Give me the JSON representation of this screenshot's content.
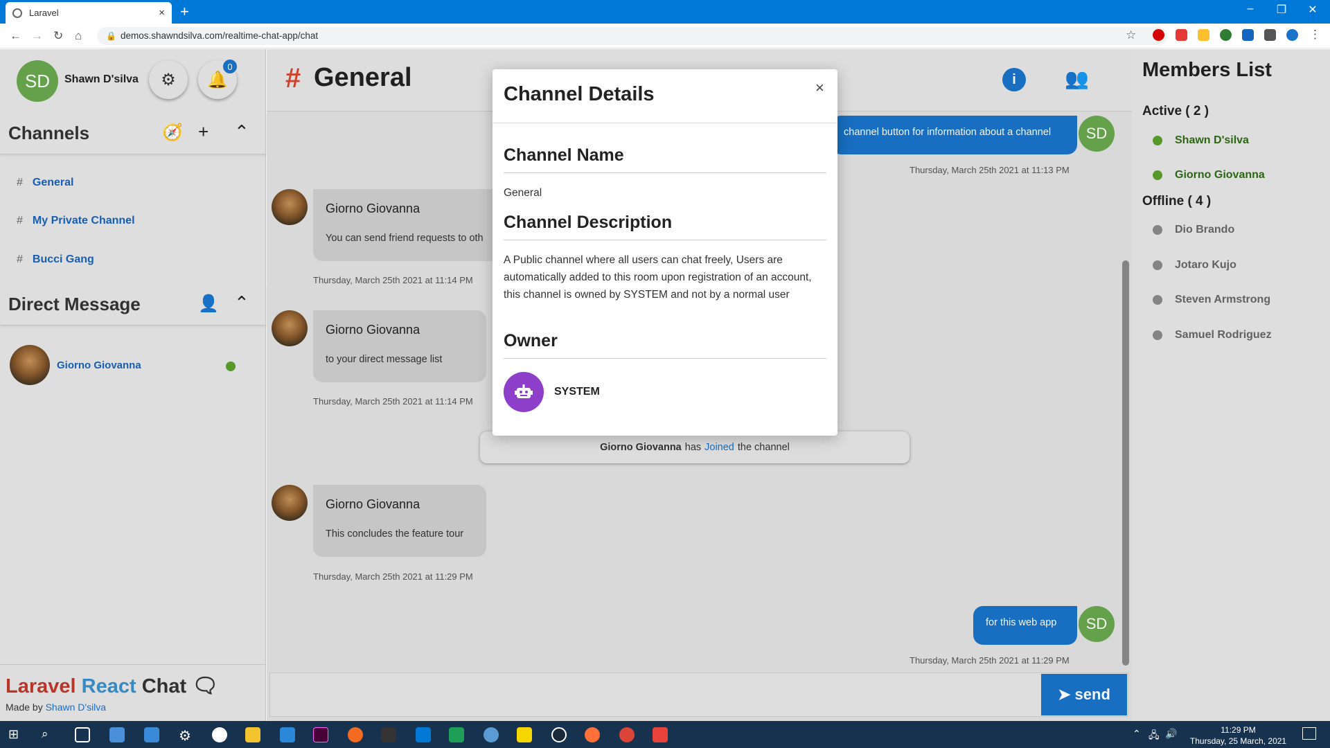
{
  "browser": {
    "tab_title": "Laravel",
    "tab_close": "×",
    "new_tab": "+",
    "url": "demos.shawndsilva.com/realtime-chat-app/chat",
    "minimize": "–",
    "restore": "❐",
    "close": "✕"
  },
  "user": {
    "initials": "SD",
    "name": "Shawn D'silva",
    "notifications": "0"
  },
  "channels": {
    "title": "Channels",
    "items": [
      {
        "hash": "#",
        "name": "General"
      },
      {
        "hash": "#",
        "name": "My Private Channel"
      },
      {
        "hash": "#",
        "name": "Bucci Gang"
      }
    ]
  },
  "direct": {
    "title": "Direct Message",
    "items": [
      {
        "name": "Giorno Giovanna",
        "status_color": "#5aa02c"
      }
    ]
  },
  "brand": {
    "laravel": "Laravel",
    "react": "React",
    "chat": "Chat",
    "made_by": "Made by",
    "author": "Shawn D'silva"
  },
  "chat": {
    "channel_hash": "#",
    "channel_name": "General",
    "info_icon": "i",
    "messages": {
      "m1": {
        "text": "channel button for information about a channel",
        "initials": "SD",
        "time": "Thursday, March 25th 2021 at 11:13 PM"
      },
      "m2": {
        "name": "Giorno Giovanna",
        "text": "You can send friend requests to oth",
        "time": "Thursday, March 25th 2021 at 11:14 PM"
      },
      "m3": {
        "name": "Giorno Giovanna",
        "text": "to your direct message list",
        "time": "Thursday, March 25th 2021 at 11:14 PM"
      },
      "join": {
        "name": "Giorno Giovanna",
        "has": "has",
        "joined": "Joined",
        "rest": "the channel"
      },
      "m4": {
        "name": "Giorno Giovanna",
        "text": "This concludes the feature tour",
        "time": "Thursday, March 25th 2021 at 11:29 PM"
      },
      "m5": {
        "text": "for this web app",
        "initials": "SD",
        "time": "Thursday, March 25th 2021 at 11:29 PM"
      }
    },
    "send_label": "send"
  },
  "members": {
    "title": "Members List",
    "active_label": "Active ( 2 )",
    "active": [
      "Shawn D'silva",
      "Giorno Giovanna"
    ],
    "offline_label": "Offline ( 4 )",
    "offline": [
      "Dio Brando",
      "Jotaro Kujo",
      "Steven Armstrong",
      "Samuel Rodriguez"
    ],
    "active_color": "#5aa02c",
    "offline_color": "#8a8a8a"
  },
  "modal": {
    "title": "Channel Details",
    "close": "×",
    "name_heading": "Channel Name",
    "name_value": "General",
    "desc_heading": "Channel Description",
    "desc_value": "A Public channel where all users can chat freely, Users are automatically added to this room upon registration of an account, this channel is owned by SYSTEM and not by a normal user",
    "owner_heading": "Owner",
    "owner_name": "SYSTEM"
  },
  "taskbar": {
    "time": "11:29 PM",
    "date": "Thursday, 25 March, 2021"
  },
  "colors": {
    "accent": "#1a73c8",
    "brand_red": "#c0392b",
    "brand_blue": "#3a8fc9",
    "online": "#5aa02c"
  }
}
